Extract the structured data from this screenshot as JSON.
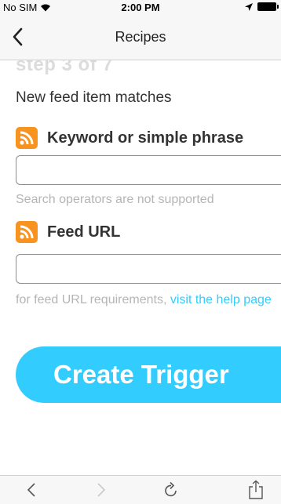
{
  "status_bar": {
    "carrier": "No SIM",
    "time": "2:00 PM"
  },
  "nav": {
    "title": "Recipes"
  },
  "content": {
    "step": "step 3 of 7",
    "trigger_description": "New feed item matches",
    "fields": [
      {
        "label": "Keyword or simple phrase",
        "value": "",
        "helper": "Search operators are not supported"
      },
      {
        "label": "Feed URL",
        "value": "",
        "helper_prefix": "for feed URL requirements, ",
        "helper_link": "visit the help page"
      }
    ],
    "create_button": "Create Trigger"
  },
  "colors": {
    "accent": "#33ccff",
    "rss": "#f7931e"
  },
  "toolbar": {
    "items": [
      "back-icon",
      "forward-icon",
      "reload-icon",
      "share-icon"
    ]
  }
}
